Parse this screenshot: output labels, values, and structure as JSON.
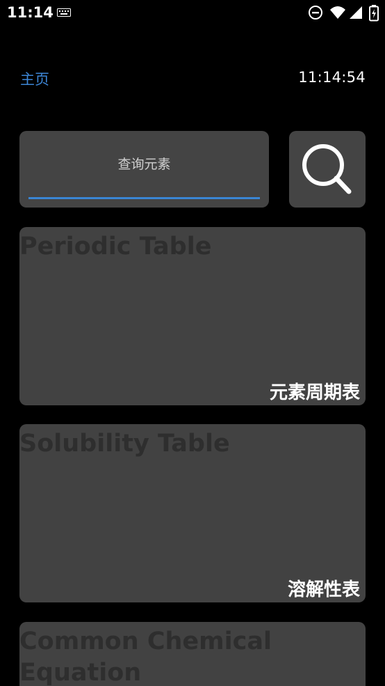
{
  "status_bar": {
    "time": "11:14",
    "icons": [
      "keyboard-icon",
      "do-not-disturb-icon",
      "wifi-icon",
      "signal-icon",
      "battery-charging-icon"
    ]
  },
  "header": {
    "home_label": "主页",
    "clock": "11:14:54"
  },
  "search": {
    "placeholder": "查询元素",
    "button_icon": "search-icon"
  },
  "cards": [
    {
      "title": "Periodic Table",
      "subtitle": "元素周期表"
    },
    {
      "title": "Solubility Table",
      "subtitle": "溶解性表"
    },
    {
      "title": "Common Chemical Equation",
      "subtitle": ""
    }
  ],
  "colors": {
    "background": "#000000",
    "card": "#424242",
    "accent": "#3a86d4",
    "card_title": "#2e2e2e"
  }
}
